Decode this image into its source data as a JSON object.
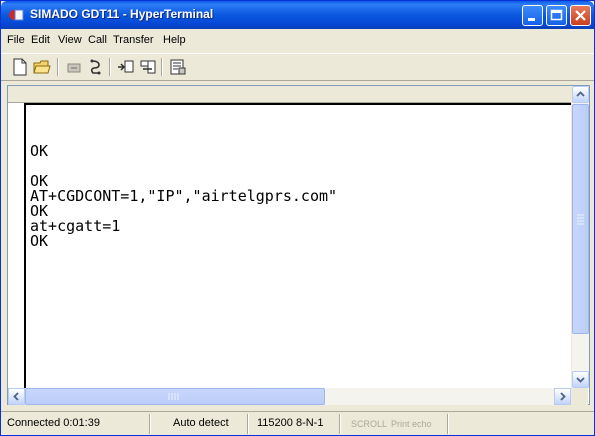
{
  "window": {
    "title_app": "SIMADO GDT11",
    "title_sep": " - ",
    "title_program": "HyperTerminal"
  },
  "menu": {
    "items": [
      "File",
      "Edit",
      "View",
      "Call",
      "Transfer",
      "Help"
    ]
  },
  "toolbar": {
    "icons": [
      "new-connection-icon",
      "open-icon",
      "disconnect-icon",
      "connect-icon",
      "send-icon",
      "receive-icon",
      "properties-icon"
    ]
  },
  "terminal": {
    "lines": [
      "",
      "OK",
      "",
      "OK",
      "AT+CGDCONT=1,\"IP\",\"airtelgprs.com\"",
      "OK",
      "at+cgatt=1",
      "OK"
    ]
  },
  "status": {
    "connected": "Connected 0:01:39",
    "detect": "Auto detect",
    "settings": "115200 8-N-1",
    "scroll": "SCROLL",
    "capture": "Print echo"
  },
  "colors": {
    "titlebar": "#0b58e0",
    "close": "#c8401d",
    "chrome": "#ece9d8"
  }
}
